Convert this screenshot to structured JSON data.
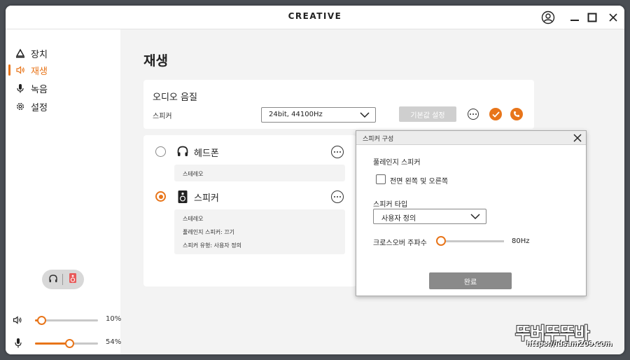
{
  "app": {
    "brand": "CREATIVE"
  },
  "sidebar": {
    "items": [
      {
        "label": "장치",
        "icon": "device-triangle-icon",
        "active": false
      },
      {
        "label": "재생",
        "icon": "speaker-playback-icon",
        "active": true
      },
      {
        "label": "녹음",
        "icon": "microphone-icon",
        "active": false
      },
      {
        "label": "설정",
        "icon": "gear-icon",
        "active": false
      }
    ],
    "volume": {
      "value_label": "10%",
      "level": 0.1
    },
    "mic": {
      "value_label": "54%",
      "level": 0.54
    }
  },
  "main": {
    "title": "재생",
    "quality": {
      "title": "오디오 음질",
      "device_label": "스피커",
      "format": "24bit, 44100Hz",
      "default_button": "기본값 설정"
    },
    "devices": [
      {
        "name": "헤드폰",
        "selected": false,
        "details": [
          "스테레오"
        ]
      },
      {
        "name": "스피커",
        "selected": true,
        "details": [
          "스테레오",
          "풀레인지 스피커: 끄기",
          "스피커 유형: 사용자 정의"
        ]
      }
    ]
  },
  "dialog": {
    "title": "스피커 구성",
    "fullrange_label": "풀레인지 스피커",
    "checkbox_label": "전면 왼쪽 및 오른쪽",
    "checkbox_checked": false,
    "type_label": "스피커 타입",
    "type_value": "사용자 정의",
    "crossover_label": "크로스오버 주파수",
    "crossover_value": "80Hz",
    "done_button": "완료"
  },
  "watermark": {
    "text": "뚜버뚜뚜바",
    "url": "https://idsam209.com"
  },
  "colors": {
    "accent": "#e8751a",
    "background": "#f3f3f3"
  }
}
